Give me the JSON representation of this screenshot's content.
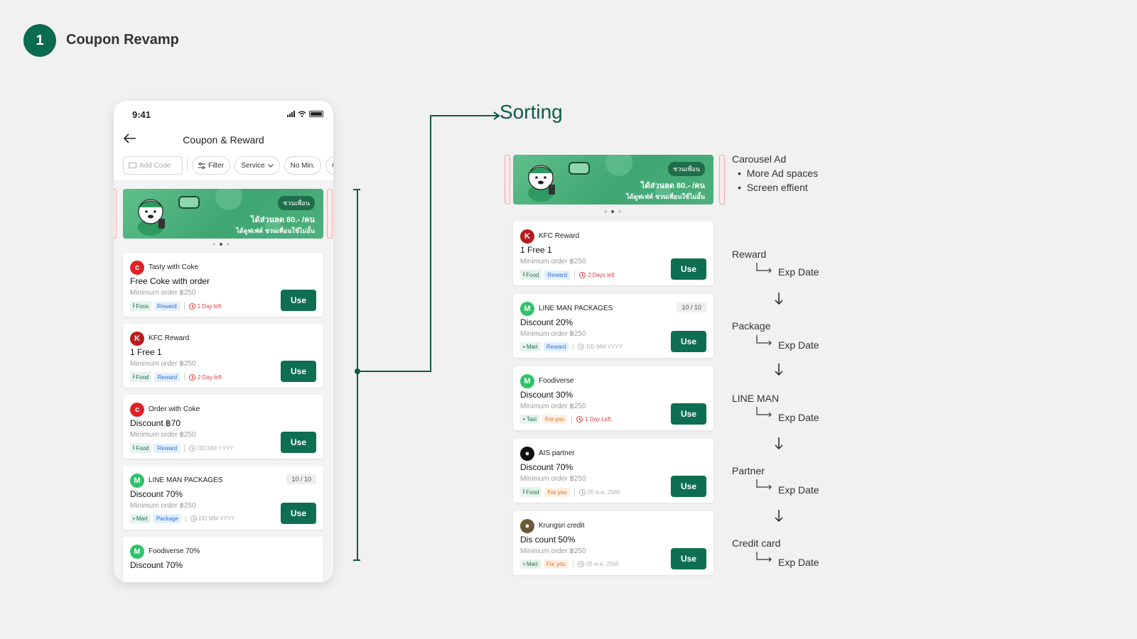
{
  "header": {
    "step": "1",
    "title": "Coupon Revamp"
  },
  "phone": {
    "time": "9:41",
    "screen_title": "Coupon & Reward",
    "filters": {
      "add_code": "Add Code",
      "filter": "Filter",
      "service": "Service",
      "no_min": "No Min.",
      "partial": "C"
    },
    "banner": {
      "badge": "ชวนเพื่อน",
      "headline": "ได้ส่วนลด 80.- /คน",
      "sub": "ได้ดูฟเฟ่ต์ ชวนเพื่อนใช้ไม่อั้น"
    },
    "cards": [
      {
        "brand": "Tasty with Coke",
        "offer": "Free Coke with order",
        "min": "Minimum order ฿250",
        "category": "Foos",
        "type": "Reward",
        "expiry": "1 Day left"
      },
      {
        "brand": "KFC Reward",
        "offer": "1 Free 1",
        "min": "Minimum order ฿250",
        "category": "Food",
        "type": "Reward",
        "expiry": "2 Day left"
      },
      {
        "brand": "Order with Coke",
        "offer": "Discount ฿70",
        "min": "Minimum order ฿250",
        "category": "Food",
        "type": "Reward",
        "expiry": "DD MM YYYY"
      },
      {
        "brand": "LINE MAN PACKAGES",
        "offer": "Discount 70%",
        "min": "Minimum order ฿250",
        "category": "Mart",
        "type": "Package",
        "expiry": "DD MM YYYY",
        "count": "10 / 10"
      },
      {
        "brand": "Foodiverse 70%",
        "offer": "Discount 70%"
      }
    ]
  },
  "sorting": {
    "title": "Sorting",
    "banner": {
      "badge": "ชวนเพื่อน",
      "headline": "ได้ส่วนลด 80.- /คน",
      "sub": "ได้ดูฟเฟ่ต์ ชวนเพื่อนใช้ไม่อั้น"
    },
    "cards": [
      {
        "brand": "KFC Reward",
        "offer": "1 Free 1",
        "min": "Minimum order ฿250",
        "category": "Food",
        "type": "Reward",
        "expiry": "2 Days left"
      },
      {
        "brand": "LINE MAN PACKAGES",
        "offer": "Discount 20%",
        "min": "Minimum order ฿250",
        "category": "Mart",
        "type": "Reward",
        "expiry": "DD MM YYYY",
        "count": "10 / 10"
      },
      {
        "brand": "Foodiverse",
        "offer": "Discount 30%",
        "min": "Minimum order ฿250",
        "category": "Taxi",
        "type": "For you",
        "expiry": "1 Day Left"
      },
      {
        "brand": "AIS partner",
        "offer": "Discount 70%",
        "min": "Minimum order ฿250",
        "category": "Food",
        "type": "For you",
        "expiry": "05 พ.ค. 2565"
      },
      {
        "brand": "Krungsri credit",
        "offer": "Dis count 50%",
        "min": "Minimum order ฿250",
        "category": "Mart",
        "type": "For you",
        "expiry": "05 พ.ค. 2565"
      }
    ],
    "use_label": "Use"
  },
  "annotations": {
    "carousel_title": "Carousel Ad",
    "bullets": [
      "More Ad spaces",
      "Screen effient"
    ],
    "order": [
      "Reward",
      "Package",
      "LINE MAN",
      "Partner",
      "Credit card"
    ],
    "exp_label": "Exp Date"
  },
  "colors": {
    "brand_green": "#0d6e52",
    "expiry_red": "#e03b3b",
    "reward_blue": "#2d6fd1",
    "foryou_orange": "#e16a1f"
  }
}
